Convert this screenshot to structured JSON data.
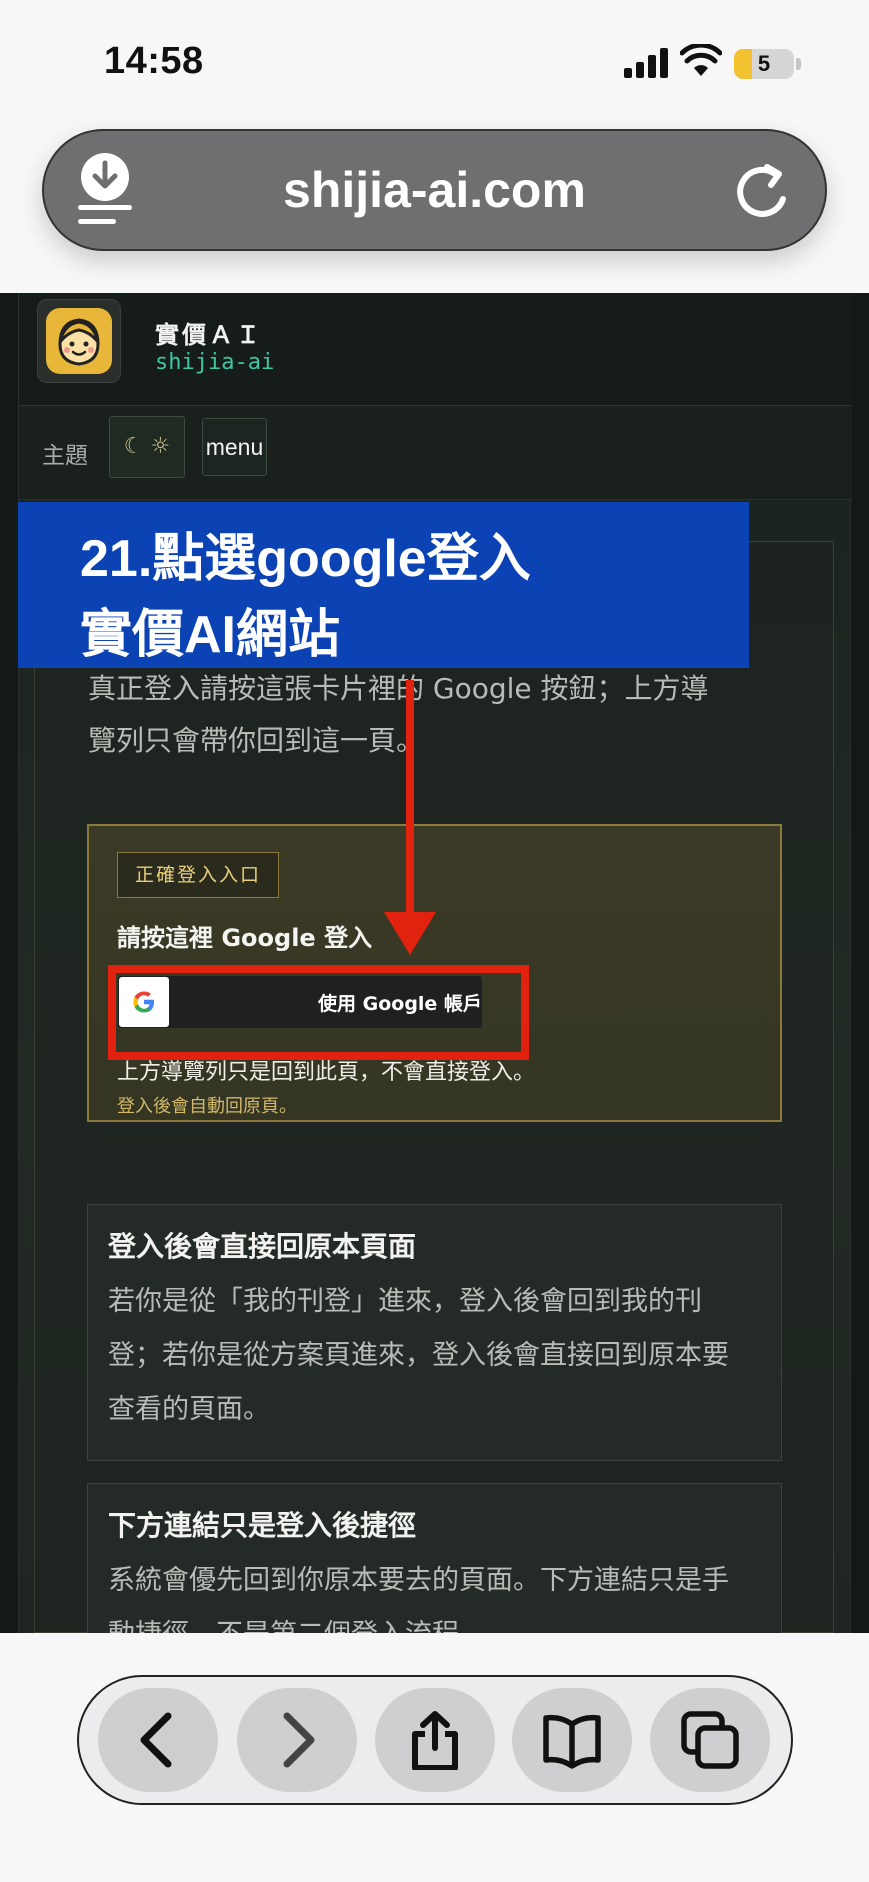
{
  "status_bar": {
    "time": "14:58",
    "battery_level": "5",
    "icons": [
      "cellular-signal-icon",
      "wifi-icon",
      "battery-icon"
    ]
  },
  "browser": {
    "url": "shijia-ai.com",
    "icons": [
      "download-icon",
      "reload-icon"
    ]
  },
  "site": {
    "brand_name": "實價ＡＩ",
    "brand_slug": "shijia-ai",
    "theme_label": "主題",
    "theme_toggle": "☾ ☼",
    "menu_label": "menu"
  },
  "overlay": {
    "line1": "21.點選google登入",
    "line2": "實價AI網站"
  },
  "intro": {
    "text": "真正登入請按這張卡片裡的 Google 按鈕；上方導覽列只會帶你回到這一頁。"
  },
  "login": {
    "badge": "正確登入入口",
    "title": "請按這裡 Google 登入",
    "google_button": "使用 Google 帳戶登入",
    "note": "上方導覽列只是回到此頁，不會直接登入。",
    "note2": "登入後會自動回原頁。"
  },
  "cards": [
    {
      "title": "登入後會直接回原本頁面",
      "body": "若你是從「我的刊登」進來，登入後會回到我的刊登；若你是從方案頁進來，登入後會直接回到原本要查看的頁面。"
    },
    {
      "title": "下方連結只是登入後捷徑",
      "body": "系統會優先回到你原本要去的頁面。下方連結只是手動捷徑，不是第二個登入流程。"
    }
  ],
  "toolbar": {
    "buttons": [
      "back-icon",
      "forward-icon",
      "share-icon",
      "bookmarks-icon",
      "tabs-icon"
    ]
  },
  "colors": {
    "banner": "#0b42b4",
    "annotation": "#e0220f",
    "brand_accent": "#3fc6a5",
    "gold": "#d2b868"
  }
}
